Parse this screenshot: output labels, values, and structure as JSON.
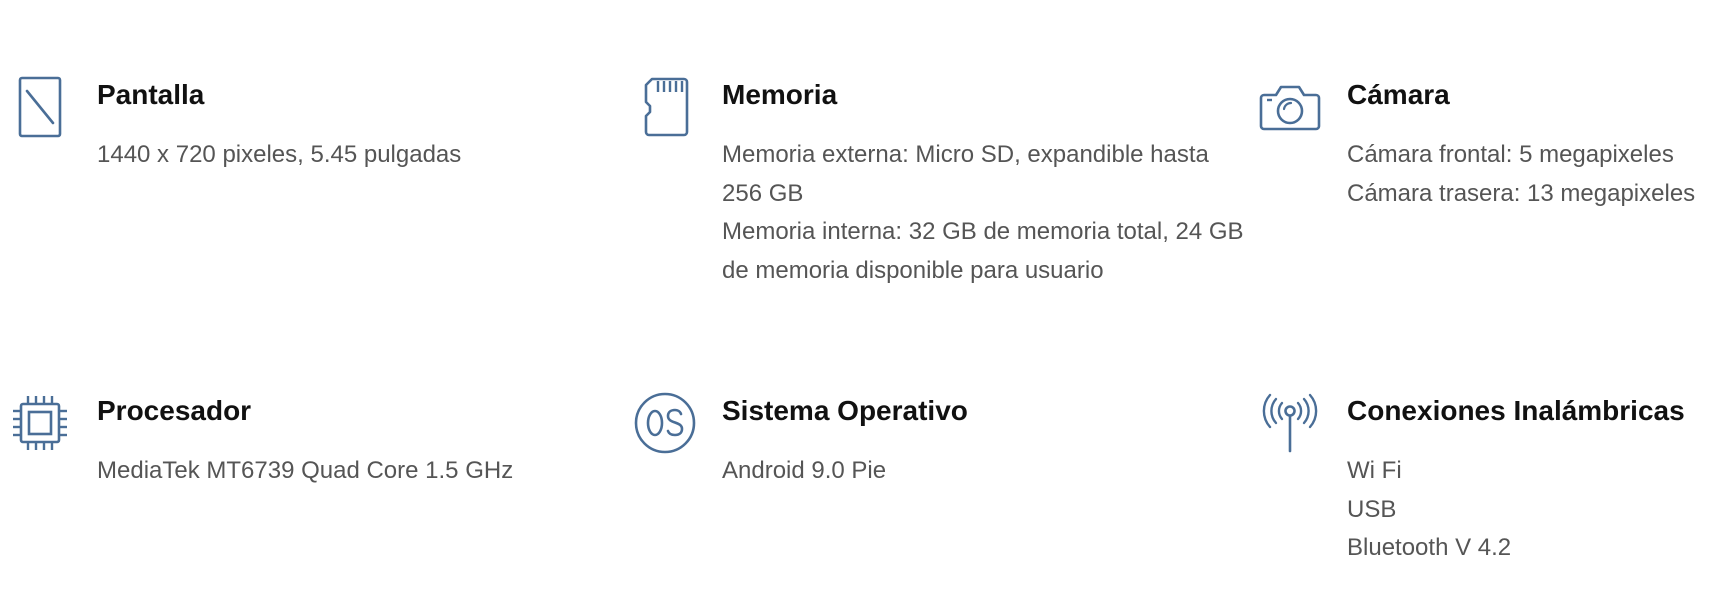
{
  "colors": {
    "icon": "#4A6E97",
    "title": "#111111",
    "body_text": "#555555",
    "background": "#FFFFFF"
  },
  "specs": [
    {
      "icon": "screen-icon",
      "title": "Pantalla",
      "lines": [
        "1440 x 720 pixeles, 5.45 pulgadas"
      ]
    },
    {
      "icon": "sd-card-icon",
      "title": "Memoria",
      "lines": [
        "Memoria externa: Micro SD, expandible hasta 256 GB",
        "Memoria interna: 32 GB de memoria total, 24 GB de memoria disponible para usuario"
      ]
    },
    {
      "icon": "camera-icon",
      "title": "Cámara",
      "lines": [
        "Cámara frontal: 5 megapixeles",
        "Cámara trasera: 13 megapixeles"
      ]
    },
    {
      "icon": "processor-chip-icon",
      "title": "Procesador",
      "lines": [
        "MediaTek MT6739 Quad Core 1.5 GHz"
      ]
    },
    {
      "icon": "os-icon",
      "title": "Sistema Operativo",
      "lines": [
        "Android 9.0 Pie"
      ]
    },
    {
      "icon": "wireless-antenna-icon",
      "title": "Conexiones Inalámbricas",
      "lines": [
        "Wi Fi",
        "USB",
        "Bluetooth V 4.2"
      ]
    }
  ]
}
